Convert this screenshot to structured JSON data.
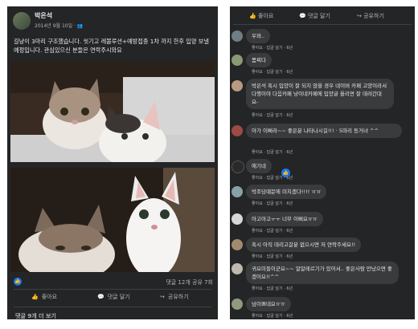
{
  "post": {
    "author": "박은석",
    "date": "2014년 9월 10일",
    "privacy_icon": "friends-icon",
    "text": "길냥이 3마리 구조했습니다. 씻기고 레볼루션+예방접종 1차 까지 한후 입양 보낼 예정입니다. 관심있으신 분들은 연락주시와요",
    "comments_count": "댓글 12개",
    "shares_count": "공유 7회",
    "like_label": "좋아요",
    "comment_label": "댓글 달기",
    "share_label": "공유하기",
    "more_comments": "댓글 9개 더 보기"
  },
  "right": {
    "like_label": "좋아요",
    "comment_label": "댓글 달기",
    "share_label": "공유하기",
    "comments": [
      {
        "text": "우와..",
        "meta": "좋아요 · 답글 달기 · 6년"
      },
      {
        "text": "몸찌다",
        "meta": "좋아요 · 답글 달기 · 6년"
      },
      {
        "text": "박은석 혹시 입양이 잘 되지 않을 경우 네이버 카페 고양이라서 다행이야 다음카페 냥이네카페에 입양글 올리면 잘 데려간대요-",
        "meta": "좋아요 · 답글 달기 · 6년"
      },
      {
        "text": "아가 이뻐라~~ 좋은분 나타나시길!!! · 5마리 동거녀 ^^",
        "meta": "좋아요 · 답글 달기 · 6년"
      },
      {
        "text": "애기네",
        "meta": "좋아요 · 답글 달기 · 6년"
      },
      {
        "text": "박조당때문에 미치겠다!!!! ㅠㅠ",
        "meta": "좋아요 · 답글 달기 · 6년"
      },
      {
        "text": "아고아고ㅜㅜ 너무 이뻐요ㅠㅠ",
        "meta": "좋아요 · 답글 달기 · 6년"
      },
      {
        "text": "혹시 아직 데리고갈분 없으시면 저 연락주세요!!",
        "meta": "좋아요 · 답글 달기 · 6년"
      },
      {
        "text": "귀요미들이군요~~ 알알레르기가 있어서.. 좋은사람 만났으면 좋겠어요!!^^",
        "meta": "좋아요 · 답글 달기 · 6년"
      },
      {
        "text": "넘이쁘네요ㅠㅠ",
        "meta": "좋아요 · 답글 달기 · 6년"
      }
    ]
  },
  "colors": {
    "panel": "#242526",
    "bubble": "#3a3b3c",
    "text": "#e4e6eb",
    "muted": "#b0b3b8",
    "accent": "#1877f2"
  }
}
